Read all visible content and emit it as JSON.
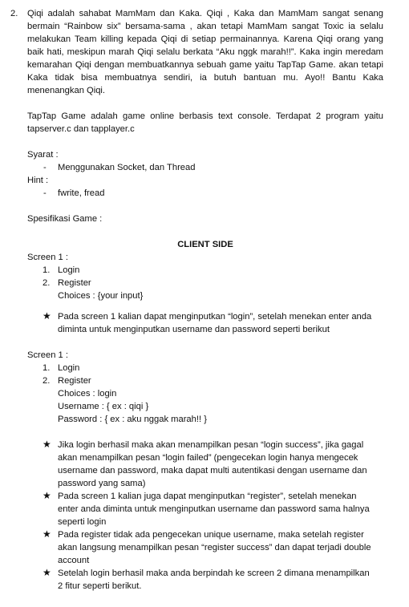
{
  "item_number": "2.",
  "intro_paragraph": "Qiqi adalah sahabat MamMam dan Kaka. Qiqi , Kaka dan MamMam sangat senang bermain “Rainbow six” bersama-sama , akan tetapi MamMam sangat Toxic ia selalu melakukan Team killing kepada Qiqi di setiap permainannya. Karena Qiqi orang yang baik hati, meskipun marah Qiqi selalu berkata “Aku nggk marah!!”. Kaka ingin meredam kemarahan Qiqi dengan membuatkannya sebuah game yaitu TapTap Game. akan tetapi Kaka tidak bisa membuatnya sendiri, ia butuh bantuan mu. Ayo!! Bantu Kaka menenangkan Qiqi.",
  "game_paragraph": "TapTap Game adalah game online berbasis text console. Terdapat 2 program yaitu tapserver.c dan tapplayer.c",
  "syarat": {
    "label": "Syarat :",
    "items": [
      "Menggunakan Socket, dan Thread"
    ]
  },
  "hint": {
    "label": "Hint :",
    "items": [
      "fwrite, fread"
    ]
  },
  "spesifikasi_label": "Spesifikasi Game :",
  "section_title": "CLIENT SIDE",
  "screen_a": {
    "label": "Screen 1 :",
    "items": [
      {
        "n": "1.",
        "text": "Login"
      },
      {
        "n": "2.",
        "text": "Register"
      }
    ],
    "extra": [
      "Choices : {your input}"
    ],
    "notes": [
      "Pada screen 1 kalian dapat menginputkan “login”, setelah menekan enter anda diminta untuk menginputkan username dan password seperti berikut"
    ]
  },
  "screen_b": {
    "label": "Screen 1 :",
    "items": [
      {
        "n": "1.",
        "text": "Login"
      },
      {
        "n": "2.",
        "text": "Register"
      }
    ],
    "extra": [
      "Choices : login",
      "Username : { ex : qiqi }",
      "Password : { ex : aku nggak marah!! }"
    ],
    "notes": [
      "Jika login berhasil maka akan menampilkan pesan “login success”, jika gagal akan menampilkan pesan “login failed” (pengecekan login hanya mengecek username dan password, maka dapat multi autentikasi dengan username dan password yang sama)",
      "Pada screen 1 kalian juga dapat menginputkan “register”, setelah menekan enter anda diminta untuk menginputkan username dan password sama halnya seperti login",
      "Pada register tidak ada pengecekan unique username, maka setelah register akan langsung menampilkan pesan “register success” dan dapat terjadi double account",
      "Setelah login berhasil maka anda berpindah ke screen 2 dimana menampilkan 2 fitur seperti berikut."
    ]
  },
  "bullets": {
    "dash": "-",
    "star": "★"
  }
}
